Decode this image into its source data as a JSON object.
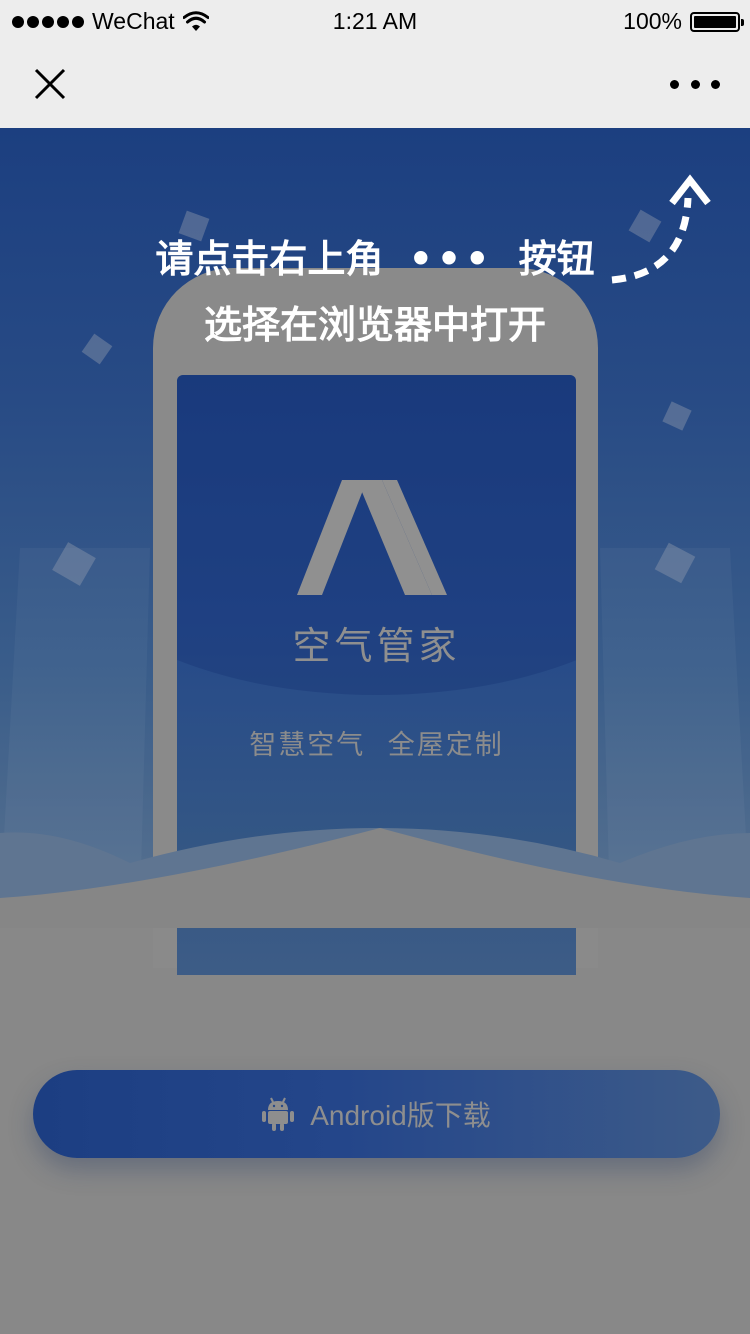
{
  "status_bar": {
    "carrier": "WeChat",
    "time": "1:21 AM",
    "battery_text": "100%",
    "battery_level": 1.0,
    "signal_dots": 5
  },
  "nav": {
    "close_icon": "close-icon",
    "more_icon": "more-icon"
  },
  "hint": {
    "line1_prefix": "请点击右上角",
    "line1_dots": "•••",
    "line1_suffix": "按钮",
    "line2": "选择在浏览器中打开"
  },
  "app": {
    "name": "空气管家",
    "slogan": "智慧空气  全屋定制"
  },
  "download": {
    "label": "Android版下载",
    "icon": "android-icon"
  },
  "colors": {
    "header_bg": "#ededed",
    "brand_blue": "#1c3e82",
    "overlay_gray": "#868686"
  }
}
